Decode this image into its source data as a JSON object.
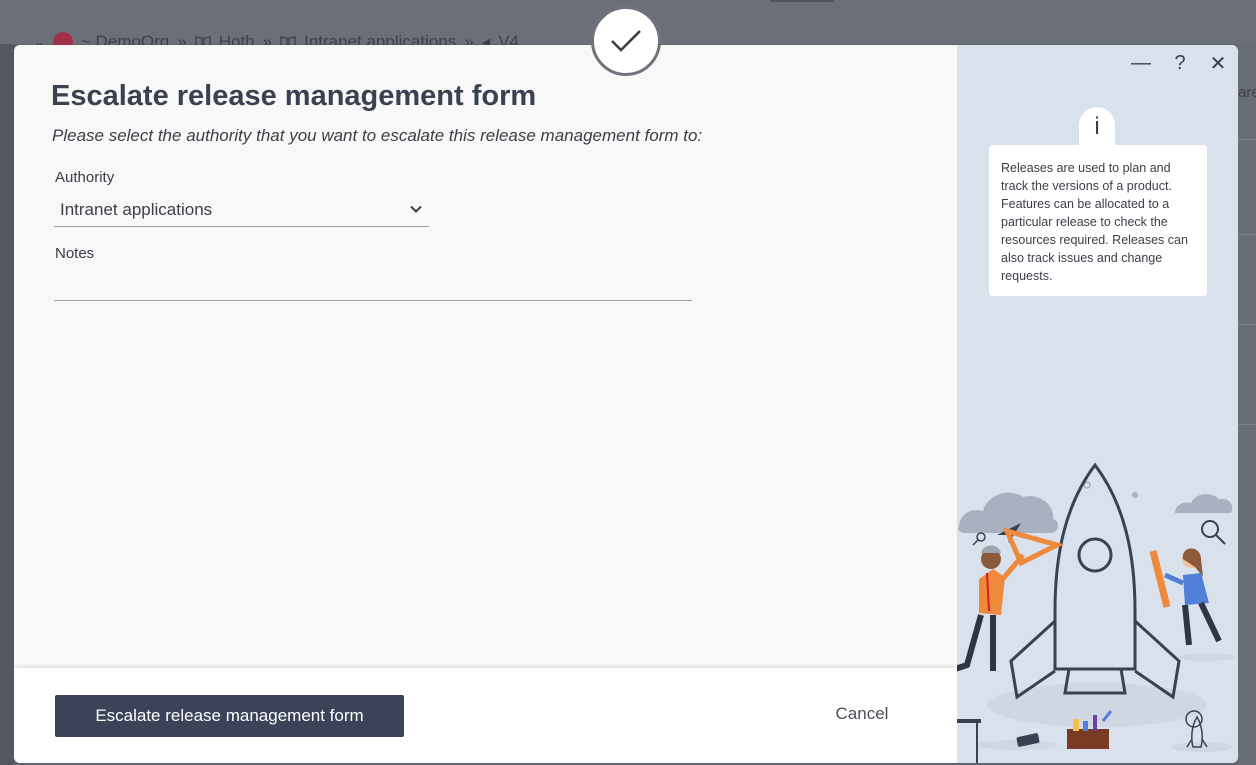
{
  "background": {
    "breadcrumb": [
      "~ DemoOrg",
      "»",
      "Hoth",
      "»",
      "Intranet applications",
      "»",
      "V4"
    ],
    "right_text": "are"
  },
  "modal": {
    "title": "Escalate release management form",
    "subtitle": "Please select the authority that you want to escalate this release management form to:",
    "authority": {
      "label": "Authority",
      "selected": "Intranet applications"
    },
    "notes": {
      "label": "Notes",
      "value": ""
    },
    "footer": {
      "primary_label": "Escalate release management form",
      "cancel_label": "Cancel"
    },
    "window_controls": {
      "minimize": "—",
      "help": "?",
      "close": "✕"
    },
    "info": {
      "icon_text": "i",
      "text": "Releases are used to plan and track the versions of a product. Features can be allocated to a particular release to check the resources required. Releases can also track issues and change requests."
    }
  },
  "icons": {
    "status": "check-icon",
    "illustration": "rocket-team-illustration"
  },
  "colors": {
    "primary_button": "#3a4357",
    "side_panel": "#d9e1ed",
    "accent_orange": "#ef8a3c",
    "accent_blue": "#4f7fd6"
  }
}
